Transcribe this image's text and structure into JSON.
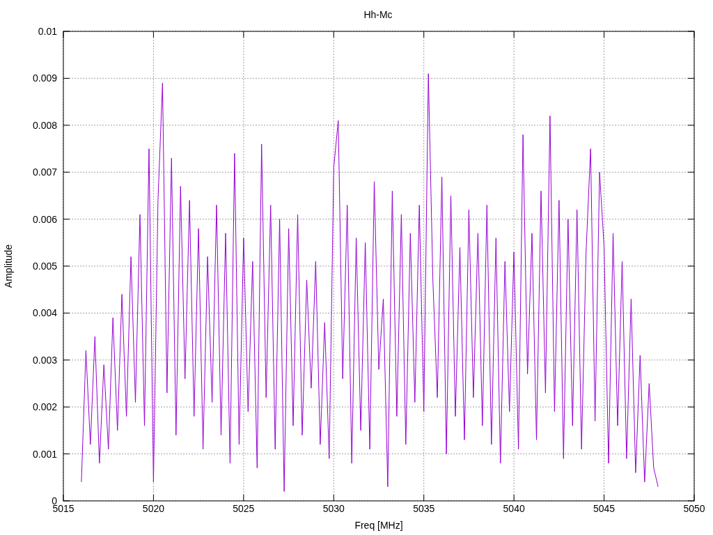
{
  "plot": {
    "chart_data": {
      "type": "line",
      "title": "Hh-Mc",
      "xlabel": "Freq [MHz]",
      "ylabel": "Amplitude",
      "grid": true,
      "xlim": [
        5015,
        5050
      ],
      "ylim": [
        0,
        0.01
      ],
      "xticks": [
        5015,
        5020,
        5025,
        5030,
        5035,
        5040,
        5045,
        5050
      ],
      "yticks": [
        {
          "value": 0,
          "label": "0"
        },
        {
          "value": 0.001,
          "label": "0.001"
        },
        {
          "value": 0.002,
          "label": "0.002"
        },
        {
          "value": 0.003,
          "label": "0.003"
        },
        {
          "value": 0.004,
          "label": "0.004"
        },
        {
          "value": 0.005,
          "label": "0.005"
        },
        {
          "value": 0.006,
          "label": "0.006"
        },
        {
          "value": 0.007,
          "label": "0.007"
        },
        {
          "value": 0.008,
          "label": "0.008"
        },
        {
          "value": 0.009,
          "label": "0.009"
        },
        {
          "value": 0.01,
          "label": "0.01"
        }
      ],
      "x": [
        5016,
        5016.25,
        5016.5,
        5016.75,
        5017,
        5017.25,
        5017.5,
        5017.75,
        5018,
        5018.25,
        5018.5,
        5018.75,
        5019,
        5019.25,
        5019.5,
        5019.75,
        5020,
        5020.25,
        5020.5,
        5020.75,
        5021,
        5021.25,
        5021.5,
        5021.75,
        5022,
        5022.25,
        5022.5,
        5022.75,
        5023,
        5023.25,
        5023.5,
        5023.75,
        5024,
        5024.25,
        5024.5,
        5024.75,
        5025,
        5025.25,
        5025.5,
        5025.75,
        5026,
        5026.25,
        5026.5,
        5026.75,
        5027,
        5027.25,
        5027.5,
        5027.75,
        5028,
        5028.25,
        5028.5,
        5028.75,
        5029,
        5029.25,
        5029.5,
        5029.75,
        5030,
        5030.25,
        5030.5,
        5030.75,
        5031,
        5031.25,
        5031.5,
        5031.75,
        5032,
        5032.25,
        5032.5,
        5032.75,
        5033,
        5033.25,
        5033.5,
        5033.75,
        5034,
        5034.25,
        5034.5,
        5034.75,
        5035,
        5035.25,
        5035.5,
        5035.75,
        5036,
        5036.25,
        5036.5,
        5036.75,
        5037,
        5037.25,
        5037.5,
        5037.75,
        5038,
        5038.25,
        5038.5,
        5038.75,
        5039,
        5039.25,
        5039.5,
        5039.75,
        5040,
        5040.25,
        5040.5,
        5040.75,
        5041,
        5041.25,
        5041.5,
        5041.75,
        5042,
        5042.25,
        5042.5,
        5042.75,
        5043,
        5043.25,
        5043.5,
        5043.75,
        5044,
        5044.25,
        5044.5,
        5044.75,
        5045,
        5045.25,
        5045.5,
        5045.75,
        5046,
        5046.25,
        5046.5,
        5046.75,
        5047,
        5047.25,
        5047.5,
        5047.75,
        5048
      ],
      "series": [
        {
          "color": "#9400d3",
          "values": [
            0.0004,
            0.0032,
            0.0012,
            0.0035,
            0.0008,
            0.0029,
            0.0011,
            0.0039,
            0.0015,
            0.0044,
            0.0018,
            0.0052,
            0.0021,
            0.0061,
            0.0016,
            0.0075,
            0.0004,
            0.0064,
            0.0089,
            0.0023,
            0.0073,
            0.0014,
            0.0067,
            0.0026,
            0.0064,
            0.0018,
            0.0058,
            0.0011,
            0.0052,
            0.0021,
            0.0063,
            0.0014,
            0.0057,
            0.0008,
            0.0074,
            0.0012,
            0.0056,
            0.0019,
            0.0051,
            0.0007,
            0.0076,
            0.0022,
            0.0063,
            0.0011,
            0.006,
            0.0002,
            0.0058,
            0.0016,
            0.0061,
            0.0014,
            0.0047,
            0.0024,
            0.0051,
            0.0012,
            0.0038,
            0.0009,
            0.0071,
            0.0081,
            0.0026,
            0.0063,
            0.0008,
            0.0056,
            0.0015,
            0.0055,
            0.0011,
            0.0068,
            0.0028,
            0.0043,
            0.0003,
            0.0066,
            0.0018,
            0.0061,
            0.0012,
            0.0057,
            0.0021,
            0.0063,
            0.0019,
            0.0091,
            0.0047,
            0.0022,
            0.0069,
            0.001,
            0.0065,
            0.0018,
            0.0054,
            0.0013,
            0.0062,
            0.0022,
            0.0057,
            0.0016,
            0.0063,
            0.0012,
            0.0056,
            0.0008,
            0.0051,
            0.0019,
            0.0053,
            0.0011,
            0.0078,
            0.0027,
            0.0057,
            0.0013,
            0.0066,
            0.0023,
            0.0082,
            0.0019,
            0.0064,
            0.0009,
            0.006,
            0.0016,
            0.0062,
            0.0011,
            0.0053,
            0.0075,
            0.0017,
            0.007,
            0.0054,
            0.0008,
            0.0057,
            0.0016,
            0.0051,
            0.0009,
            0.0043,
            0.0006,
            0.0031,
            0.0004,
            0.0025,
            0.0007,
            0.0003
          ]
        }
      ]
    }
  }
}
